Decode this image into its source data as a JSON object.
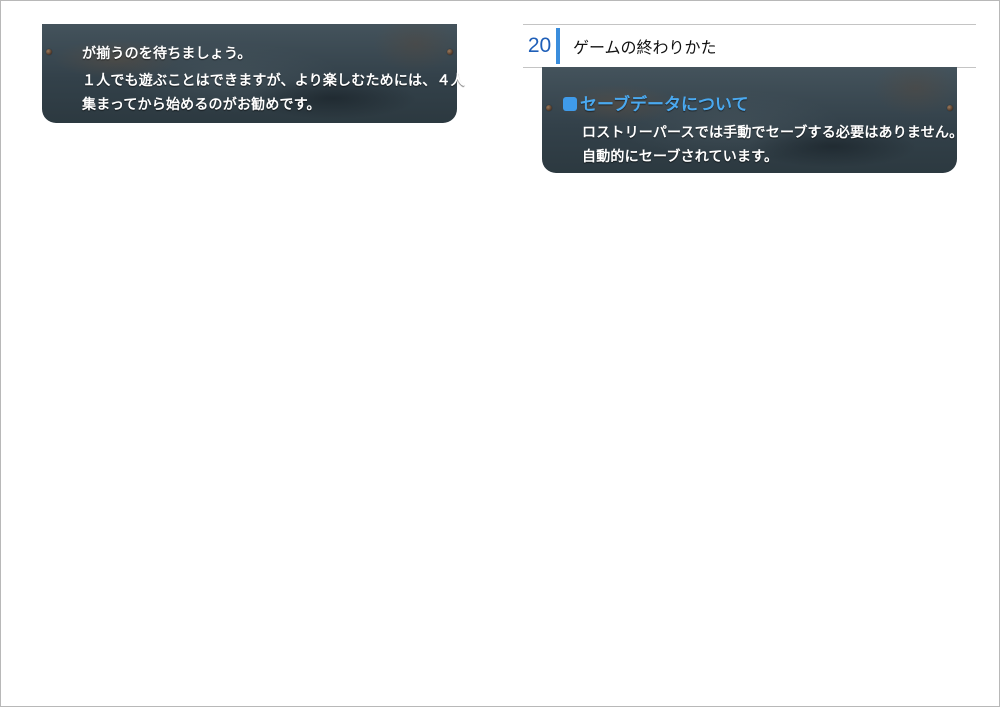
{
  "left_panel": {
    "lines": [
      "が揃うのを待ちましょう。",
      "１人でも遊ぶことはできますが、より楽しむためには、４人",
      "集まってから始めるのがお勧めです。"
    ]
  },
  "right_panel": {
    "page_number": "20",
    "page_title": "ゲームの終わりかた",
    "section_heading": "セーブデータについて",
    "lines": [
      "ロストリーパースでは手動でセーブする必要はありません。",
      "自動的にセーブされています。"
    ]
  },
  "colors": {
    "accent_blue": "#3a8ddc",
    "heading_blue": "#4aa9f0",
    "page_number_blue": "#1f5fb8",
    "plate_steel": "#3b4952"
  }
}
